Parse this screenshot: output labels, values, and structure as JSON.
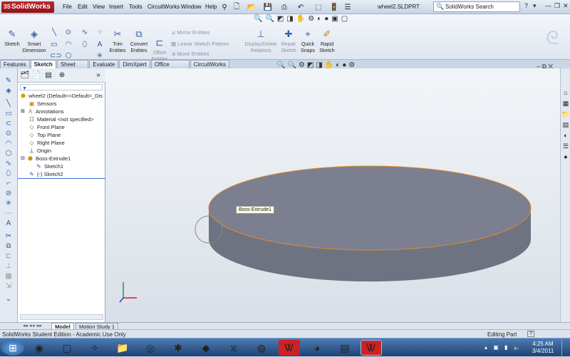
{
  "app": {
    "title": "SolidWorks",
    "doc_title": "wheel2.SLDPRT"
  },
  "menu": [
    "File",
    "Edit",
    "View",
    "Insert",
    "Tools",
    "CircuitWorks",
    "Window",
    "Help"
  ],
  "search": {
    "placeholder": "SolidWorks Search"
  },
  "commands": {
    "sketch": "Sketch",
    "smart_dimension": "Smart Dimension",
    "trim": "Trim Entities",
    "convert": "Convert Entities",
    "offset": "Offset Entities",
    "mirror": "Mirror Entities",
    "linear_pattern": "Linear Sketch Pattern",
    "move": "Move Entities",
    "display_delete": "Display/Delete Relations",
    "repair": "Repair Sketch",
    "quick_snaps": "Quick Snaps",
    "rapid": "Rapid Sketch"
  },
  "tabs": [
    "Features",
    "Sketch",
    "Sheet Metal",
    "Evaluate",
    "DimXpert",
    "Office Products",
    "CircuitWorks"
  ],
  "active_tab": "Sketch",
  "tree": {
    "root": "wheel2  (Default<<Default>_Dis",
    "items": [
      "Sensors",
      "Annotations",
      "Material <not specified>",
      "Front Plane",
      "Top Plane",
      "Right Plane",
      "Origin",
      "Boss-Extrude1",
      "Sketch1",
      "(-) Sketch2"
    ]
  },
  "tooltip": "Boss-Extrude1",
  "bottom_tabs": [
    "Model",
    "Motion Study 1"
  ],
  "status": {
    "left": "SolidWorks Student Edition - Academic Use Only",
    "right": "Editing Part",
    "help": "?"
  },
  "clock": {
    "time": "4:25 AM",
    "date": "3/4/2011"
  },
  "colors": {
    "brand": "#b0191b",
    "part": "#6e7382",
    "part_top": "#7b7f8f",
    "edge": "#e08a2a",
    "taskbar": "#2a5a95"
  }
}
